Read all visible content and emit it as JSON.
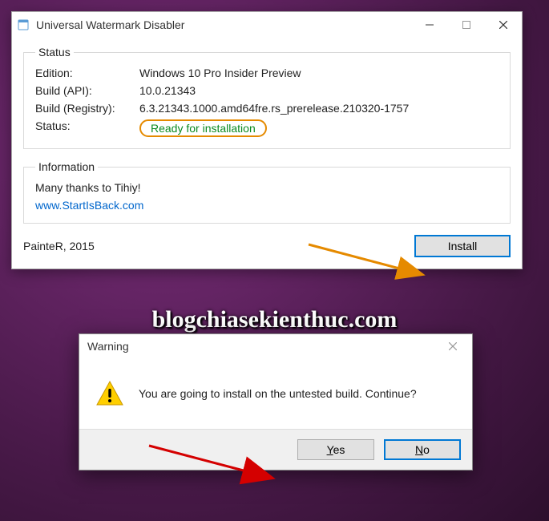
{
  "main": {
    "title": "Universal Watermark Disabler",
    "status_group_label": "Status",
    "fields": {
      "edition_k": "Edition:",
      "edition_v": "Windows 10 Pro Insider Preview",
      "build_api_k": "Build (API):",
      "build_api_v": "10.0.21343",
      "build_reg_k": "Build (Registry):",
      "build_reg_v": "6.3.21343.1000.amd64fre.rs_prerelease.210320-1757",
      "status_k": "Status:",
      "status_v": "Ready for installation"
    },
    "info_group_label": "Information",
    "info_text": "Many thanks to Tihiy!",
    "info_link": "www.StartIsBack.com",
    "credit": "PainteR, 2015",
    "install_label": "Install"
  },
  "warning": {
    "title": "Warning",
    "message": "You are going to install on the untested build. Continue?",
    "yes_label": "Yes",
    "no_label": "No"
  },
  "watermark": "blogchiasekienthuc.com"
}
